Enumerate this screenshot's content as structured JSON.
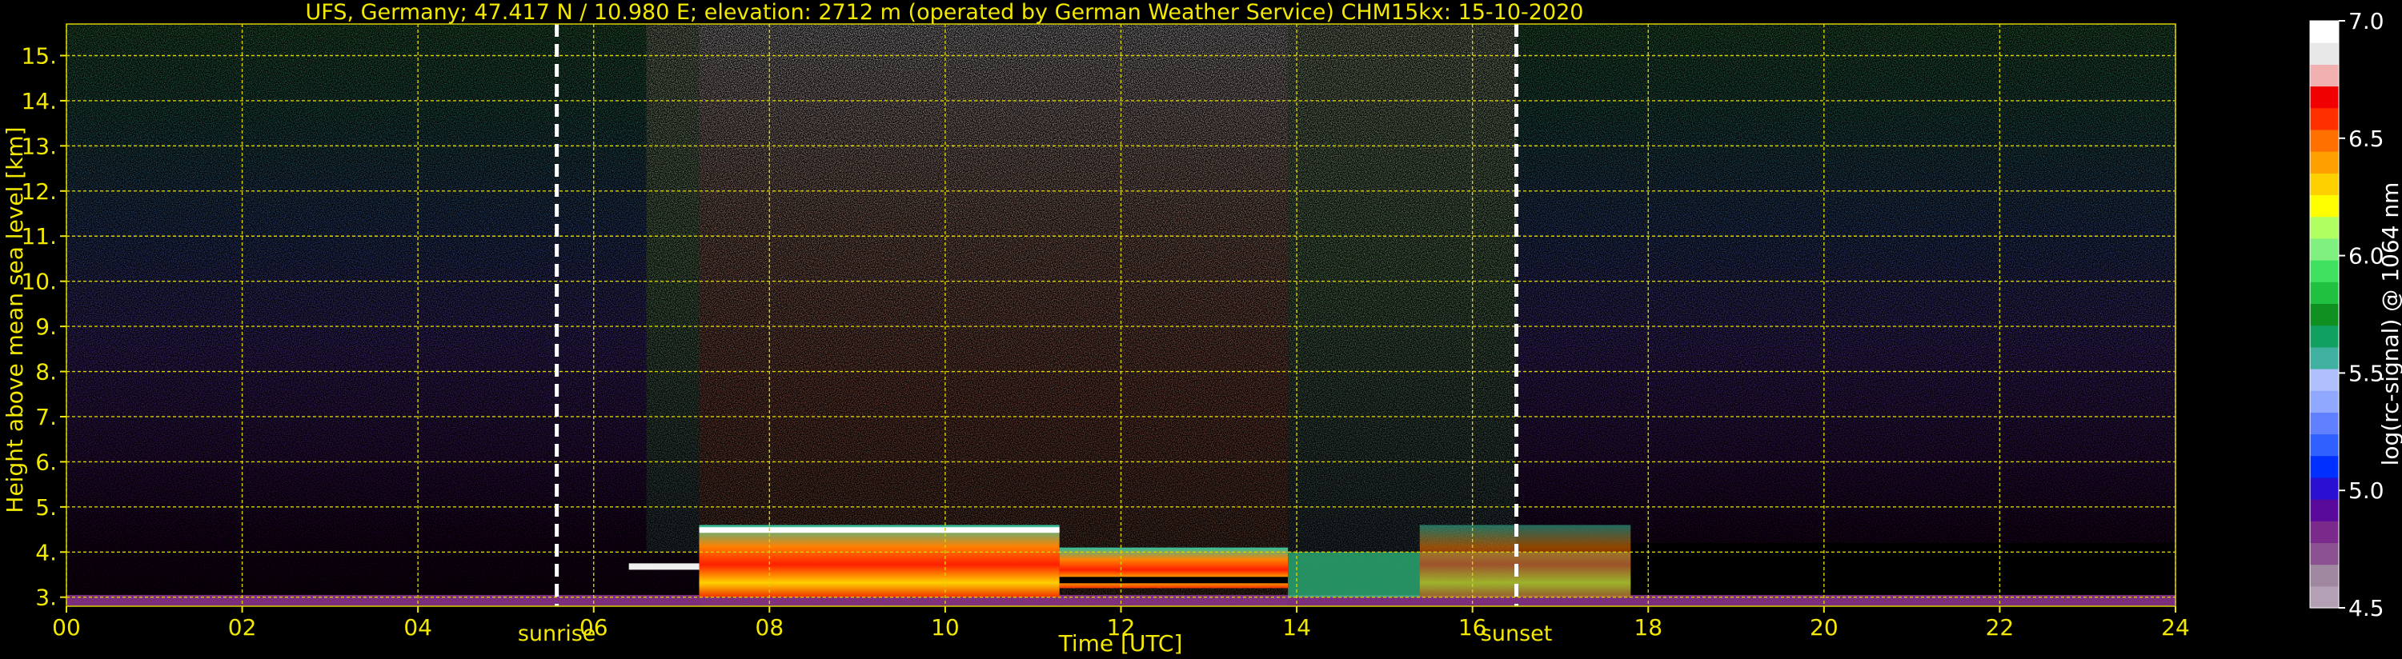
{
  "chart_data": {
    "type": "heatmap",
    "title": "UFS, Germany; 47.417 N / 10.980 E; elevation: 2712 m  (operated by German Weather Service)     CHM15kx: 15-10-2020",
    "xlabel": "Time [UTC]",
    "ylabel": "Height above mean sea level [km]",
    "colorbar_label": "log(rc-signal) @ 1064 nm",
    "xlim": [
      0,
      24
    ],
    "ylim": [
      2.8,
      15.7
    ],
    "clim": [
      4.5,
      7.0
    ],
    "grid": true,
    "x_ticks": [
      "00",
      "02",
      "04",
      "06",
      "08",
      "10",
      "12",
      "14",
      "16",
      "18",
      "20",
      "22",
      "24"
    ],
    "y_ticks": [
      "3.",
      "4.",
      "5.",
      "6.",
      "7.",
      "8.",
      "9.",
      "10.",
      "11.",
      "12.",
      "13.",
      "14.",
      "15."
    ],
    "colorbar_ticks": [
      "4.5",
      "5.0",
      "5.5",
      "6.0",
      "6.5",
      "7.0"
    ],
    "annotations": [
      {
        "label": "sunrise",
        "time": 5.58
      },
      {
        "label": "sunset",
        "time": 16.5
      }
    ],
    "colors": {
      "text": "#f2e800",
      "grid": "#d8d000",
      "annotation_line": "#ffffff",
      "colorbar_scale": [
        "#b4a0b4",
        "#a088a0",
        "#8a5090",
        "#7a2a8a",
        "#5a0a9a",
        "#2a10d0",
        "#0030ff",
        "#3060ff",
        "#6080ff",
        "#90a8ff",
        "#b0c0ff",
        "#40b0a0",
        "#10a060",
        "#109020",
        "#20c040",
        "#40e060",
        "#80f080",
        "#b0ff60",
        "#ffff00",
        "#ffd000",
        "#ffa000",
        "#ff7000",
        "#ff3000",
        "#f00000",
        "#f0b0b0",
        "#e8e8e8",
        "#ffffff"
      ]
    }
  }
}
